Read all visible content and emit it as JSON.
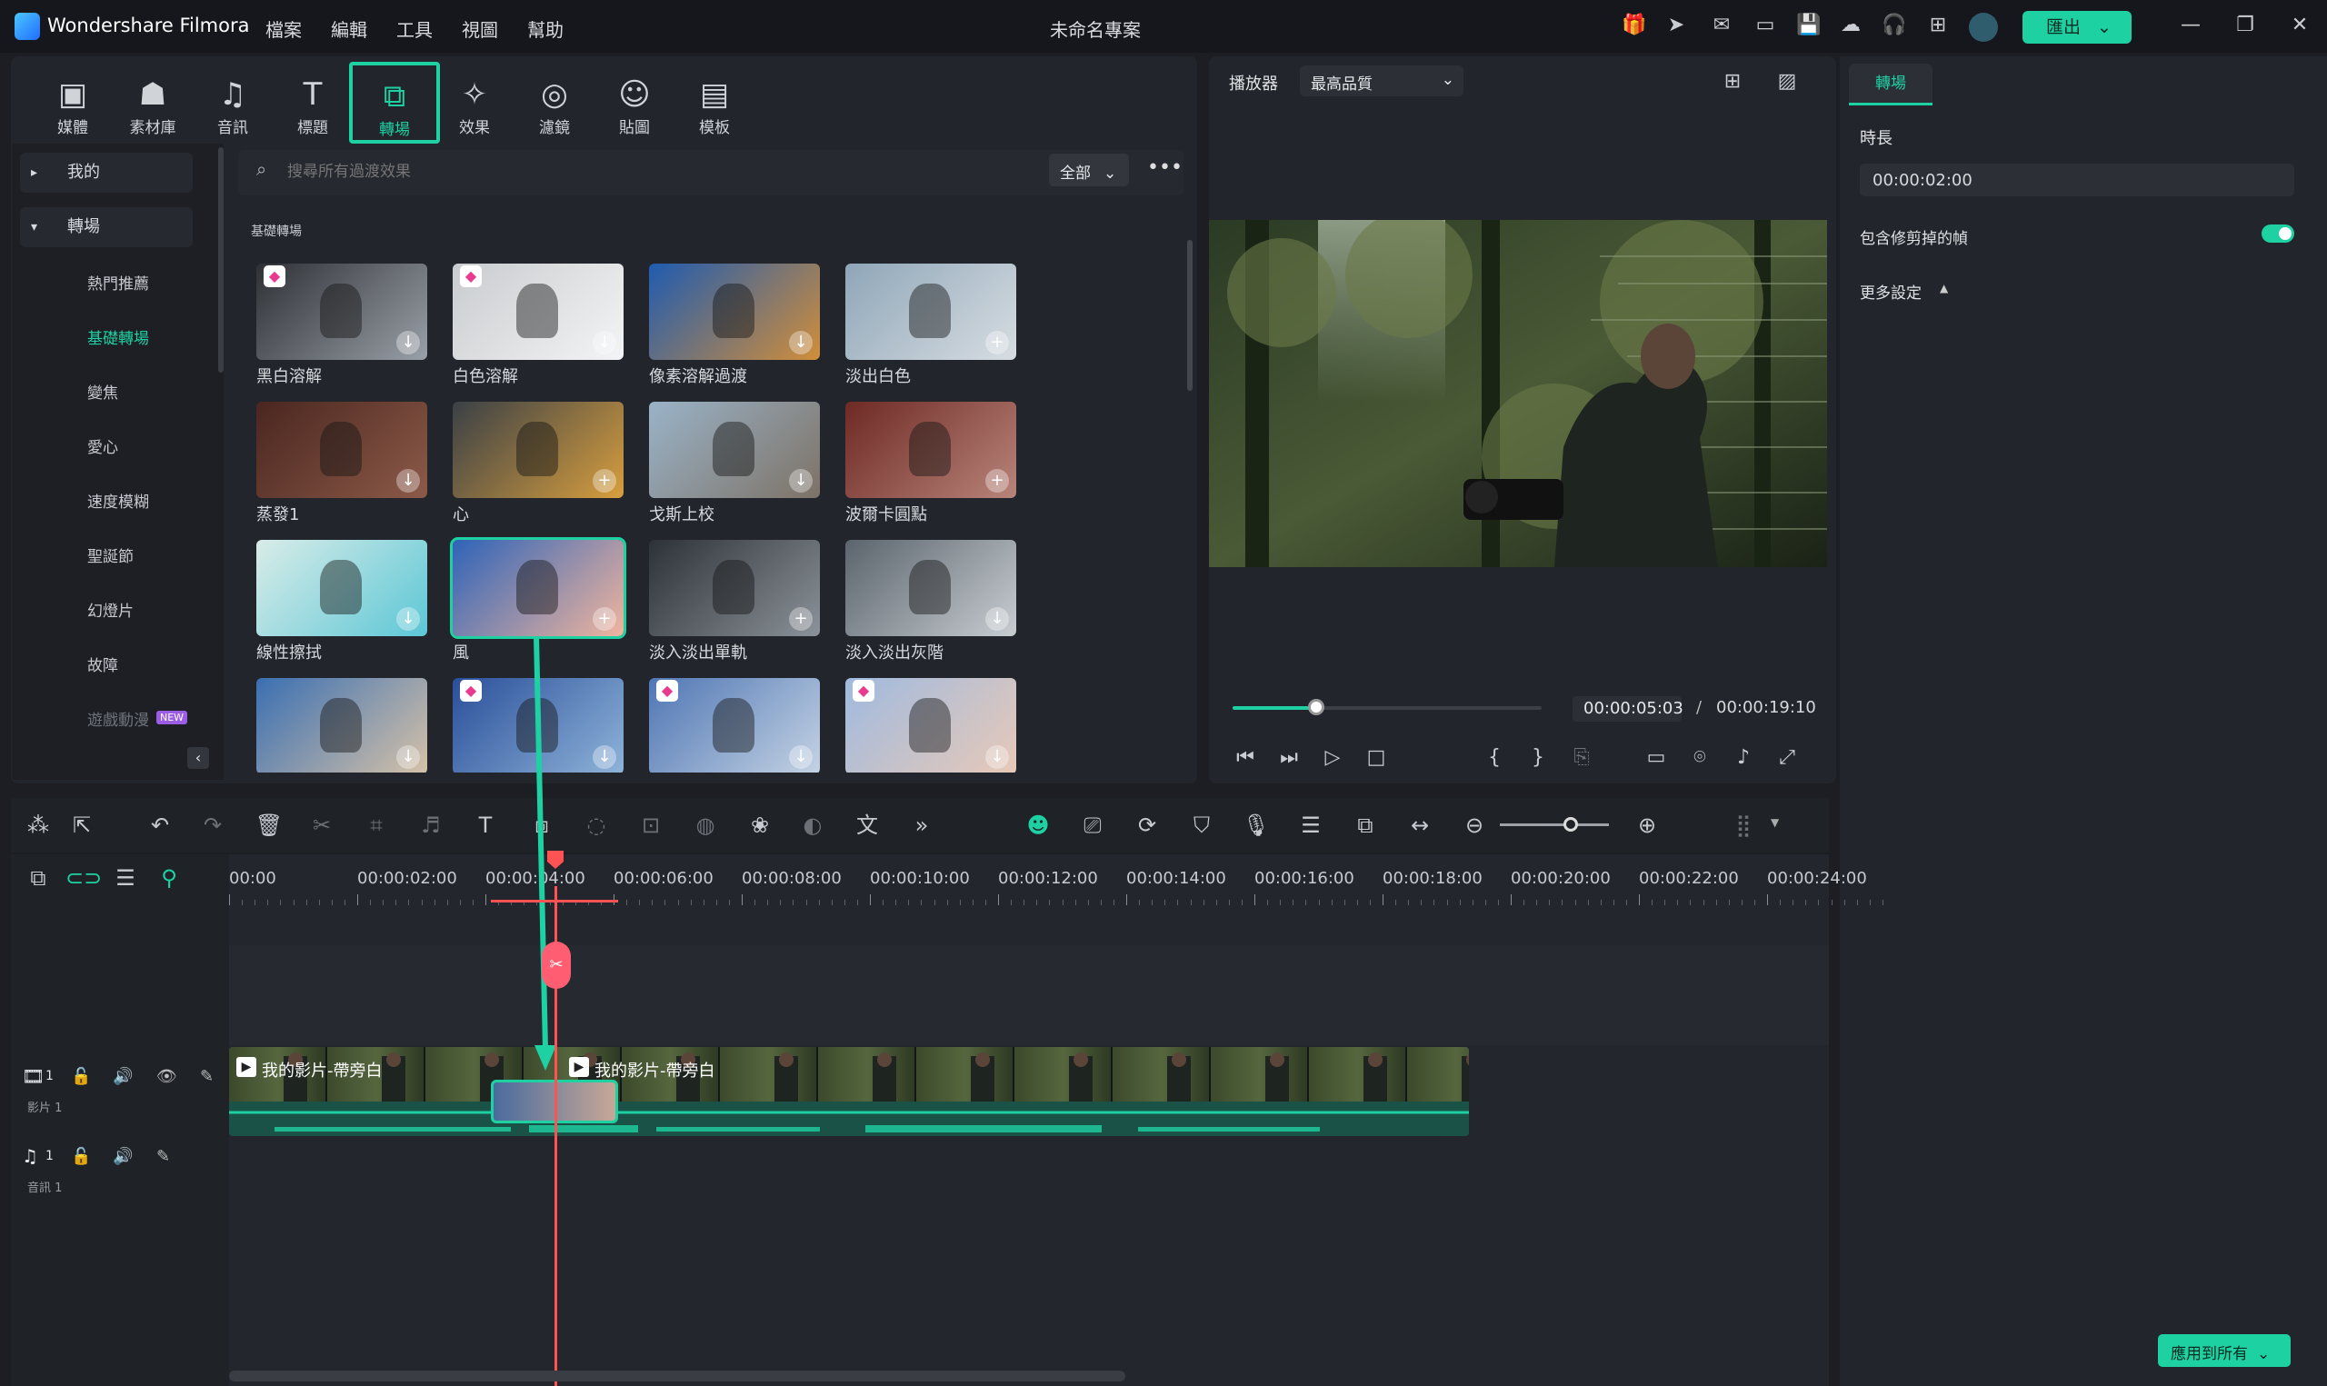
{
  "app": {
    "name": "Wondershare Filmora",
    "project_title": "未命名專案",
    "export_label": "匯出"
  },
  "menu": [
    "檔案",
    "編輯",
    "工具",
    "視圖",
    "幫助"
  ],
  "tabs": [
    {
      "label": "媒體",
      "icon": "media-icon"
    },
    {
      "label": "素材庫",
      "icon": "stock-icon"
    },
    {
      "label": "音訊",
      "icon": "audio-icon"
    },
    {
      "label": "標題",
      "icon": "title-icon"
    },
    {
      "label": "轉場",
      "icon": "transition-icon"
    },
    {
      "label": "效果",
      "icon": "effects-icon"
    },
    {
      "label": "濾鏡",
      "icon": "filters-icon"
    },
    {
      "label": "貼圖",
      "icon": "stickers-icon"
    },
    {
      "label": "模板",
      "icon": "templates-icon"
    }
  ],
  "sidebar": {
    "groups": [
      "我的",
      "轉場"
    ],
    "items": [
      "熱門推薦",
      "基礎轉場",
      "變焦",
      "愛心",
      "速度模糊",
      "聖誕節",
      "幻燈片",
      "故障",
      "遊戲動漫"
    ],
    "new_badge": "NEW"
  },
  "search": {
    "placeholder": "搜尋所有過渡效果",
    "filter": "全部"
  },
  "section_title": "基礎轉場",
  "transitions": [
    {
      "label": "黑白溶解",
      "premium": true,
      "action": "download"
    },
    {
      "label": "白色溶解",
      "premium": true,
      "action": "download"
    },
    {
      "label": "像素溶解過渡",
      "premium": false,
      "action": "download"
    },
    {
      "label": "淡出白色",
      "premium": false,
      "action": "add"
    },
    {
      "label": "蒸發1",
      "premium": false,
      "action": "download"
    },
    {
      "label": "心",
      "premium": false,
      "action": "add"
    },
    {
      "label": "戈斯上校",
      "premium": false,
      "action": "download"
    },
    {
      "label": "波爾卡圓點",
      "premium": false,
      "action": "add"
    },
    {
      "label": "線性擦拭",
      "premium": false,
      "action": "download"
    },
    {
      "label": "風",
      "premium": false,
      "action": "add"
    },
    {
      "label": "淡入淡出單軌",
      "premium": false,
      "action": "add"
    },
    {
      "label": "淡入淡出灰階",
      "premium": false,
      "action": "download"
    },
    {
      "label": "",
      "premium": false,
      "action": "download"
    },
    {
      "label": "",
      "premium": true,
      "action": "download"
    },
    {
      "label": "",
      "premium": true,
      "action": "download"
    },
    {
      "label": "",
      "premium": true,
      "action": "download"
    }
  ],
  "player": {
    "label": "播放器",
    "quality": "最高品質",
    "current_time": "00:00:05:03",
    "total_time": "00:00:19:10",
    "progress": 0.27
  },
  "props": {
    "tab": "轉場",
    "duration_label": "時長",
    "duration_value": "00:00:02:00",
    "include_trimmed": "包含修剪掉的幀",
    "more_settings": "更多設定",
    "apply_all": "應用到所有"
  },
  "ruler": [
    "00:00",
    "00:00:02:00",
    "00:00:04:00",
    "00:00:06:00",
    "00:00:08:00",
    "00:00:10:00",
    "00:00:12:00",
    "00:00:14:00",
    "00:00:16:00",
    "00:00:18:00",
    "00:00:20:00",
    "00:00:22:00",
    "00:00:24:00"
  ],
  "tracks": {
    "video_label": "影片 1",
    "audio_label": "音訊 1",
    "clip1": "我的影片-帶旁白",
    "clip2": "我的影片-帶旁白",
    "video_num": "1",
    "audio_num": "1"
  }
}
